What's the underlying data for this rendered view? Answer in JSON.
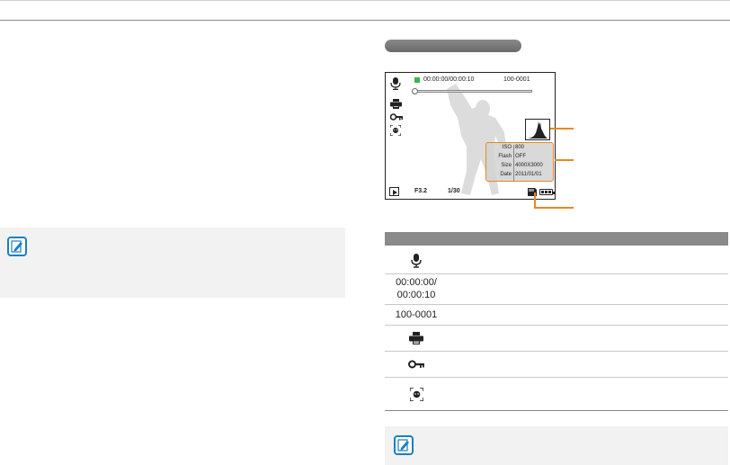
{
  "screen": {
    "timecode": "00:00:00/00:00:10",
    "file_number": "100-0001",
    "aperture": "F3.2",
    "shutter": "1/30",
    "info": [
      {
        "key": "ISO",
        "value": "800"
      },
      {
        "key": "Flash",
        "value": "OFF"
      },
      {
        "key": "Size",
        "value": "4000X3000"
      },
      {
        "key": "Date",
        "value": "2011/01/01"
      }
    ],
    "video_progress": 0.0
  },
  "table": {
    "rows": [
      {
        "icon": "voice-memo-icon",
        "text": ""
      },
      {
        "icon": "",
        "text": "00:00:00/\n00:00:10"
      },
      {
        "icon": "",
        "text": "100-0001"
      },
      {
        "icon": "print-icon",
        "text": ""
      },
      {
        "icon": "protect-key-icon",
        "text": ""
      },
      {
        "icon": "face-recognition-icon",
        "text": ""
      }
    ]
  },
  "colors": {
    "callout": "#e58a1f",
    "note_icon": "#1a7ec4",
    "header_bg": "#8a8a8a",
    "note_bg": "#f2f2f2"
  }
}
